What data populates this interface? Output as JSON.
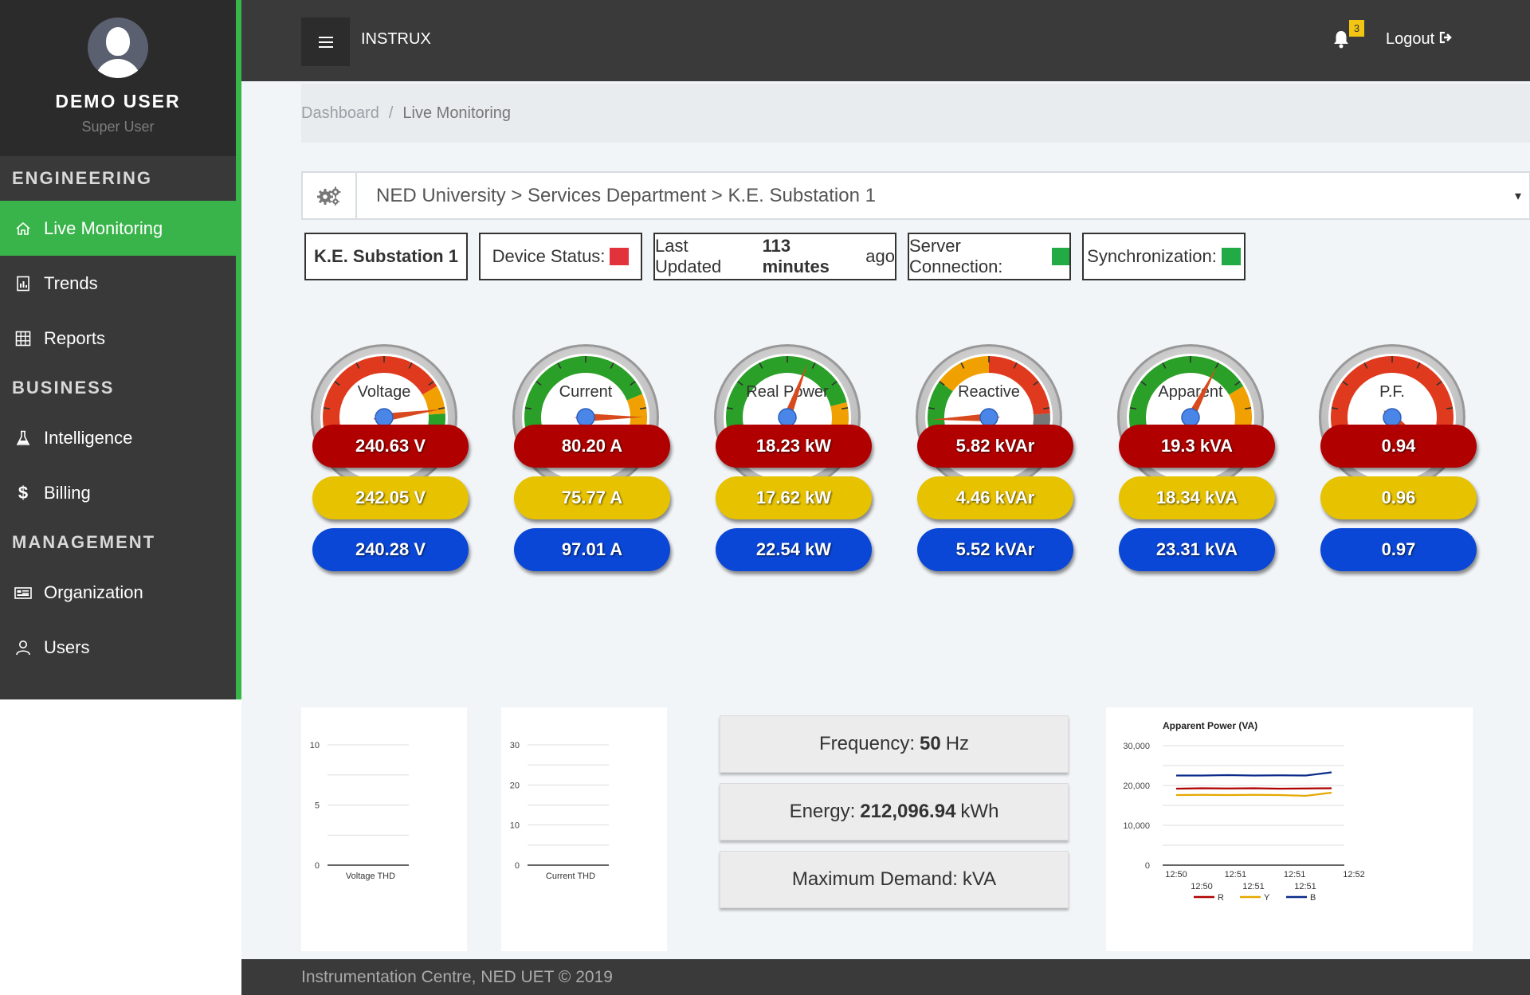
{
  "user": {
    "name": "DEMO USER",
    "role": "Super User"
  },
  "sidebar": {
    "sections": [
      {
        "title": "ENGINEERING",
        "items": [
          {
            "label": "Live Monitoring",
            "icon": "home-icon",
            "active": true
          },
          {
            "label": "Trends",
            "icon": "chart-doc-icon"
          },
          {
            "label": "Reports",
            "icon": "table-icon"
          }
        ]
      },
      {
        "title": "BUSINESS",
        "items": [
          {
            "label": "Intelligence",
            "icon": "flask-icon"
          },
          {
            "label": "Billing",
            "icon": "dollar-icon"
          }
        ]
      },
      {
        "title": "MANAGEMENT",
        "items": [
          {
            "label": "Organization",
            "icon": "building-icon"
          },
          {
            "label": "Users",
            "icon": "user-icon"
          }
        ]
      }
    ]
  },
  "topbar": {
    "brand": "INSTRUX",
    "notifications": "3",
    "logout": "Logout"
  },
  "breadcrumb": {
    "home": "Dashboard",
    "separator": "/",
    "current": "Live Monitoring"
  },
  "selector": {
    "path": "NED University > Services Department > K.E. Substation 1",
    "caret": "▾"
  },
  "status": {
    "station": "K.E. Substation 1",
    "device_label": "Device Status:",
    "device_color": "#e2333d",
    "updated_prefix": "Last Updated",
    "updated_value": "113 minutes",
    "updated_suffix": "ago",
    "server_label": "Server Connection:",
    "server_color": "#22aa44",
    "sync_label": "Synchronization:",
    "sync_color": "#22aa44"
  },
  "gauges": [
    {
      "title": "Voltage",
      "min": "0",
      "max": "300",
      "value": 241,
      "range": [
        0,
        300
      ],
      "reading": "241 V"
    },
    {
      "title": "Current",
      "min": "0",
      "max": "300",
      "value": 249.57,
      "range": [
        0,
        300
      ],
      "reading": "249.57 A"
    },
    {
      "title": "Real Power",
      "min": "0",
      "max": "100",
      "value": 57.55,
      "range": [
        0,
        100
      ],
      "reading": "57.55 KW"
    },
    {
      "title": "Reactive",
      "min": "0",
      "max": "100",
      "value": 15.85,
      "range": [
        0,
        100
      ],
      "reading": "15.85 KVAr"
    },
    {
      "title": "Apparent",
      "min": "0",
      "max": "100",
      "value": 60.13,
      "range": [
        0,
        100
      ],
      "reading": "60.13 KVA"
    },
    {
      "title": "P.F.",
      "min": "-1",
      "max": "1",
      "value": 0.96,
      "range": [
        -1,
        1
      ],
      "reading": "0.96"
    }
  ],
  "phases": {
    "voltage": {
      "r": "240.63 V",
      "y": "242.05 V",
      "b": "240.28 V"
    },
    "current": {
      "r": "80.20 A",
      "y": "75.77 A",
      "b": "97.01 A"
    },
    "real": {
      "r": "18.23 kW",
      "y": "17.62 kW",
      "b": "22.54 kW"
    },
    "reactive": {
      "r": "5.82 kVAr",
      "y": "4.46 kVAr",
      "b": "5.52 kVAr"
    },
    "apparent": {
      "r": "19.3 kVA",
      "y": "18.34 kVA",
      "b": "23.31 kVA"
    },
    "pf": {
      "r": "0.94",
      "y": "0.96",
      "b": "0.97"
    }
  },
  "info": {
    "frequency_label": "Frequency:",
    "frequency_value": "50",
    "frequency_unit": "Hz",
    "energy_label": "Energy:",
    "energy_value": "212,096.94",
    "energy_unit": "kWh",
    "demand_label": "Maximum Demand:",
    "demand_unit": "kVA"
  },
  "chart_data": [
    {
      "type": "line",
      "title": "",
      "xlabel": "Voltage THD",
      "ylabel": "",
      "ylim": [
        0,
        10
      ],
      "yticks": [
        "0",
        "5",
        "10"
      ],
      "series": []
    },
    {
      "type": "line",
      "title": "",
      "xlabel": "Current THD",
      "ylabel": "",
      "ylim": [
        0,
        30
      ],
      "yticks": [
        "0",
        "10",
        "20",
        "30"
      ],
      "series": []
    },
    {
      "type": "line",
      "title": "Apparent Power (VA)",
      "ylim": [
        0,
        30000
      ],
      "yticks": [
        "0",
        "10,000",
        "20,000",
        "30,000"
      ],
      "x_labels_top": [
        "12:50",
        "12:51",
        "12:51",
        "12:52"
      ],
      "x_labels_bottom": [
        "12:50",
        "12:51",
        "12:51"
      ],
      "legend_position": "bottom",
      "series": [
        {
          "name": "R",
          "color": "#b00000",
          "values": [
            19200,
            19300,
            19250,
            19300,
            19200,
            19250,
            19300
          ]
        },
        {
          "name": "Y",
          "color": "#e6a800",
          "values": [
            17600,
            17650,
            17600,
            17650,
            17600,
            17400,
            18200
          ]
        },
        {
          "name": "B",
          "color": "#0a2a8a",
          "values": [
            22500,
            22500,
            22600,
            22500,
            22550,
            22500,
            23300
          ]
        }
      ]
    }
  ],
  "footer": {
    "text": "Instrumentation Centre, NED UET © 2019"
  }
}
